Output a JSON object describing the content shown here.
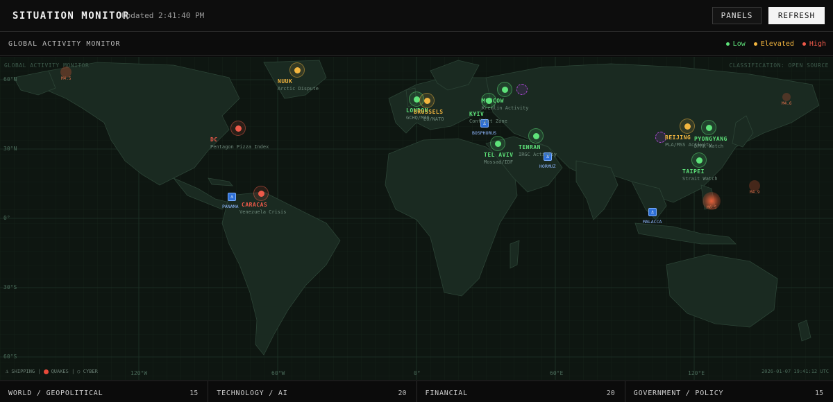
{
  "header": {
    "title": "SITUATION MONITOR",
    "updated": "Updated 2:41:40 PM",
    "panels_label": "PANELS",
    "refresh_label": "REFRESH"
  },
  "panel": {
    "title": "GLOBAL ACTIVITY MONITOR",
    "legend": [
      {
        "label": "Low",
        "color": "#5ee37a"
      },
      {
        "label": "Elevated",
        "color": "#f4b63f"
      },
      {
        "label": "High",
        "color": "#f05a4a"
      }
    ]
  },
  "map": {
    "corner_left": "GLOBAL ACTIVITY MONITOR",
    "corner_right": "CLASSIFICATION: OPEN SOURCE",
    "latitudes": [
      "60°N",
      "30°N",
      "0°",
      "30°S",
      "60°S"
    ],
    "longitudes": [
      "120°W",
      "60°W",
      "0°",
      "60°E",
      "120°E"
    ],
    "footer_legend": {
      "shipping": "⚓ SHIPPING |",
      "quakes": "QUAKES |",
      "cyber": "○ CYBER"
    },
    "timestamp": "2026-01-07 19:41:12 UTC",
    "hotspots": [
      {
        "name": "NUUK",
        "sub": "Arctic Dispute",
        "level": "elevated"
      },
      {
        "name": "DC",
        "sub": "Pentagon Pizza Index",
        "level": "high"
      },
      {
        "name": "CARACAS",
        "sub": "Venezuela Crisis",
        "level": "high"
      },
      {
        "name": "LONDON",
        "sub": "GCHQ/MI6",
        "level": "low"
      },
      {
        "name": "BRUSSELS",
        "sub": "EU/NATO",
        "level": "elevated"
      },
      {
        "name": "MOSCOW",
        "sub": "Kremlin Activity",
        "level": "low"
      },
      {
        "name": "KYIV",
        "sub": "Conflict Zone",
        "level": "low"
      },
      {
        "name": "TEL AVIV",
        "sub": "Mossad/IDF",
        "level": "low"
      },
      {
        "name": "TEHRAN",
        "sub": "IRGC Activity",
        "level": "low"
      },
      {
        "name": "BEIJING",
        "sub": "PLA/MSS Activity",
        "level": "elevated"
      },
      {
        "name": "PYONGYANG",
        "sub": "DPRK Watch",
        "level": "low"
      },
      {
        "name": "TAIPEI",
        "sub": "Strait Watch",
        "level": "low"
      }
    ],
    "shipping": [
      {
        "name": "PANAMA"
      },
      {
        "name": "BOSPHORUS"
      },
      {
        "name": "HORMUZ"
      },
      {
        "name": "MALACCA"
      }
    ],
    "quakes": [
      {
        "mag": "M4.5"
      },
      {
        "mag": "M4.6"
      },
      {
        "mag": "M4.9"
      },
      {
        "mag": "M6.5"
      }
    ]
  },
  "tabs": [
    {
      "label": "WORLD / GEOPOLITICAL",
      "count": "15"
    },
    {
      "label": "TECHNOLOGY / AI",
      "count": "20"
    },
    {
      "label": "FINANCIAL",
      "count": "20"
    },
    {
      "label": "GOVERNMENT / POLICY",
      "count": "15"
    }
  ],
  "colors": {
    "low": "#5ee37a",
    "elevated": "#f4b63f",
    "high": "#f05a4a",
    "land": "#1a2a21",
    "ocean": "#0e1611"
  }
}
